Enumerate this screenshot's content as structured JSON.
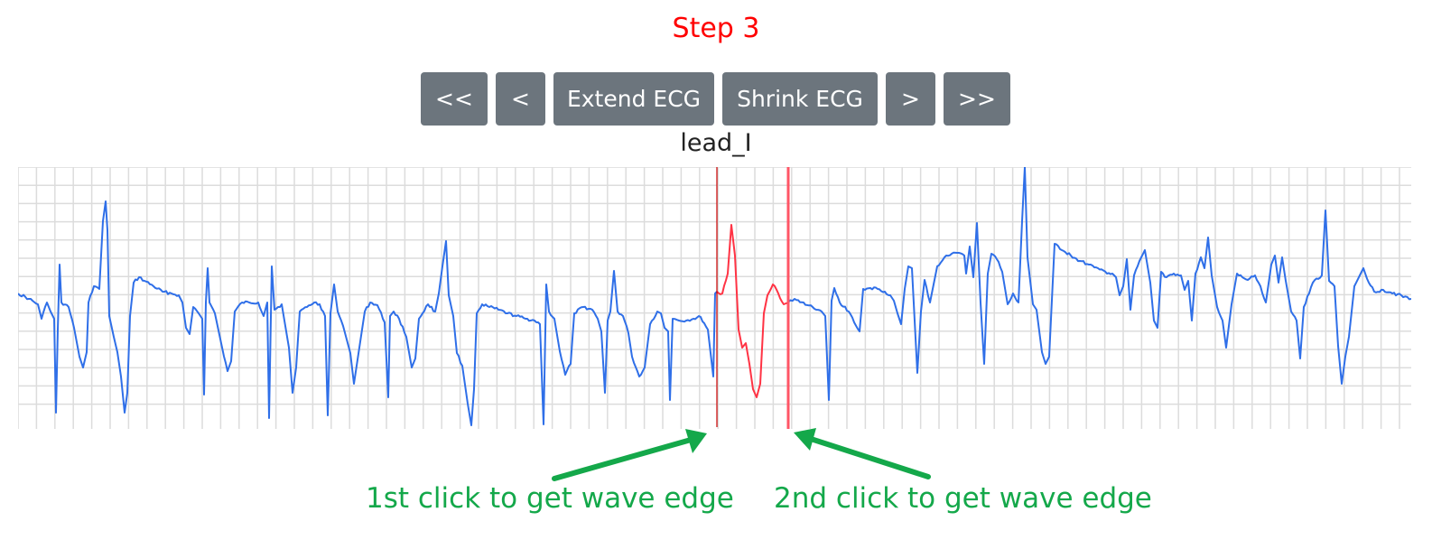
{
  "title": "Step 3",
  "toolbar": {
    "first_label": "<<",
    "prev_label": "<",
    "extend_label": "Extend ECG",
    "shrink_label": "Shrink ECG",
    "next_label": ">",
    "last_label": ">>"
  },
  "lead": {
    "label": "lead_I"
  },
  "annotations": {
    "first_click": "1st click to get wave edge",
    "second_click": "2nd click to get wave edge"
  },
  "colors": {
    "title": "#ff0000",
    "button_bg": "#6c757d",
    "button_text": "#ffffff",
    "trace": "#2f6fe8",
    "selection": "#ff3344",
    "marker": "#cc0000",
    "annotation": "#14a84a",
    "grid": "#dcdcdc"
  },
  "icons": [
    "arrow-up-right-icon",
    "arrow-up-left-icon"
  ]
}
